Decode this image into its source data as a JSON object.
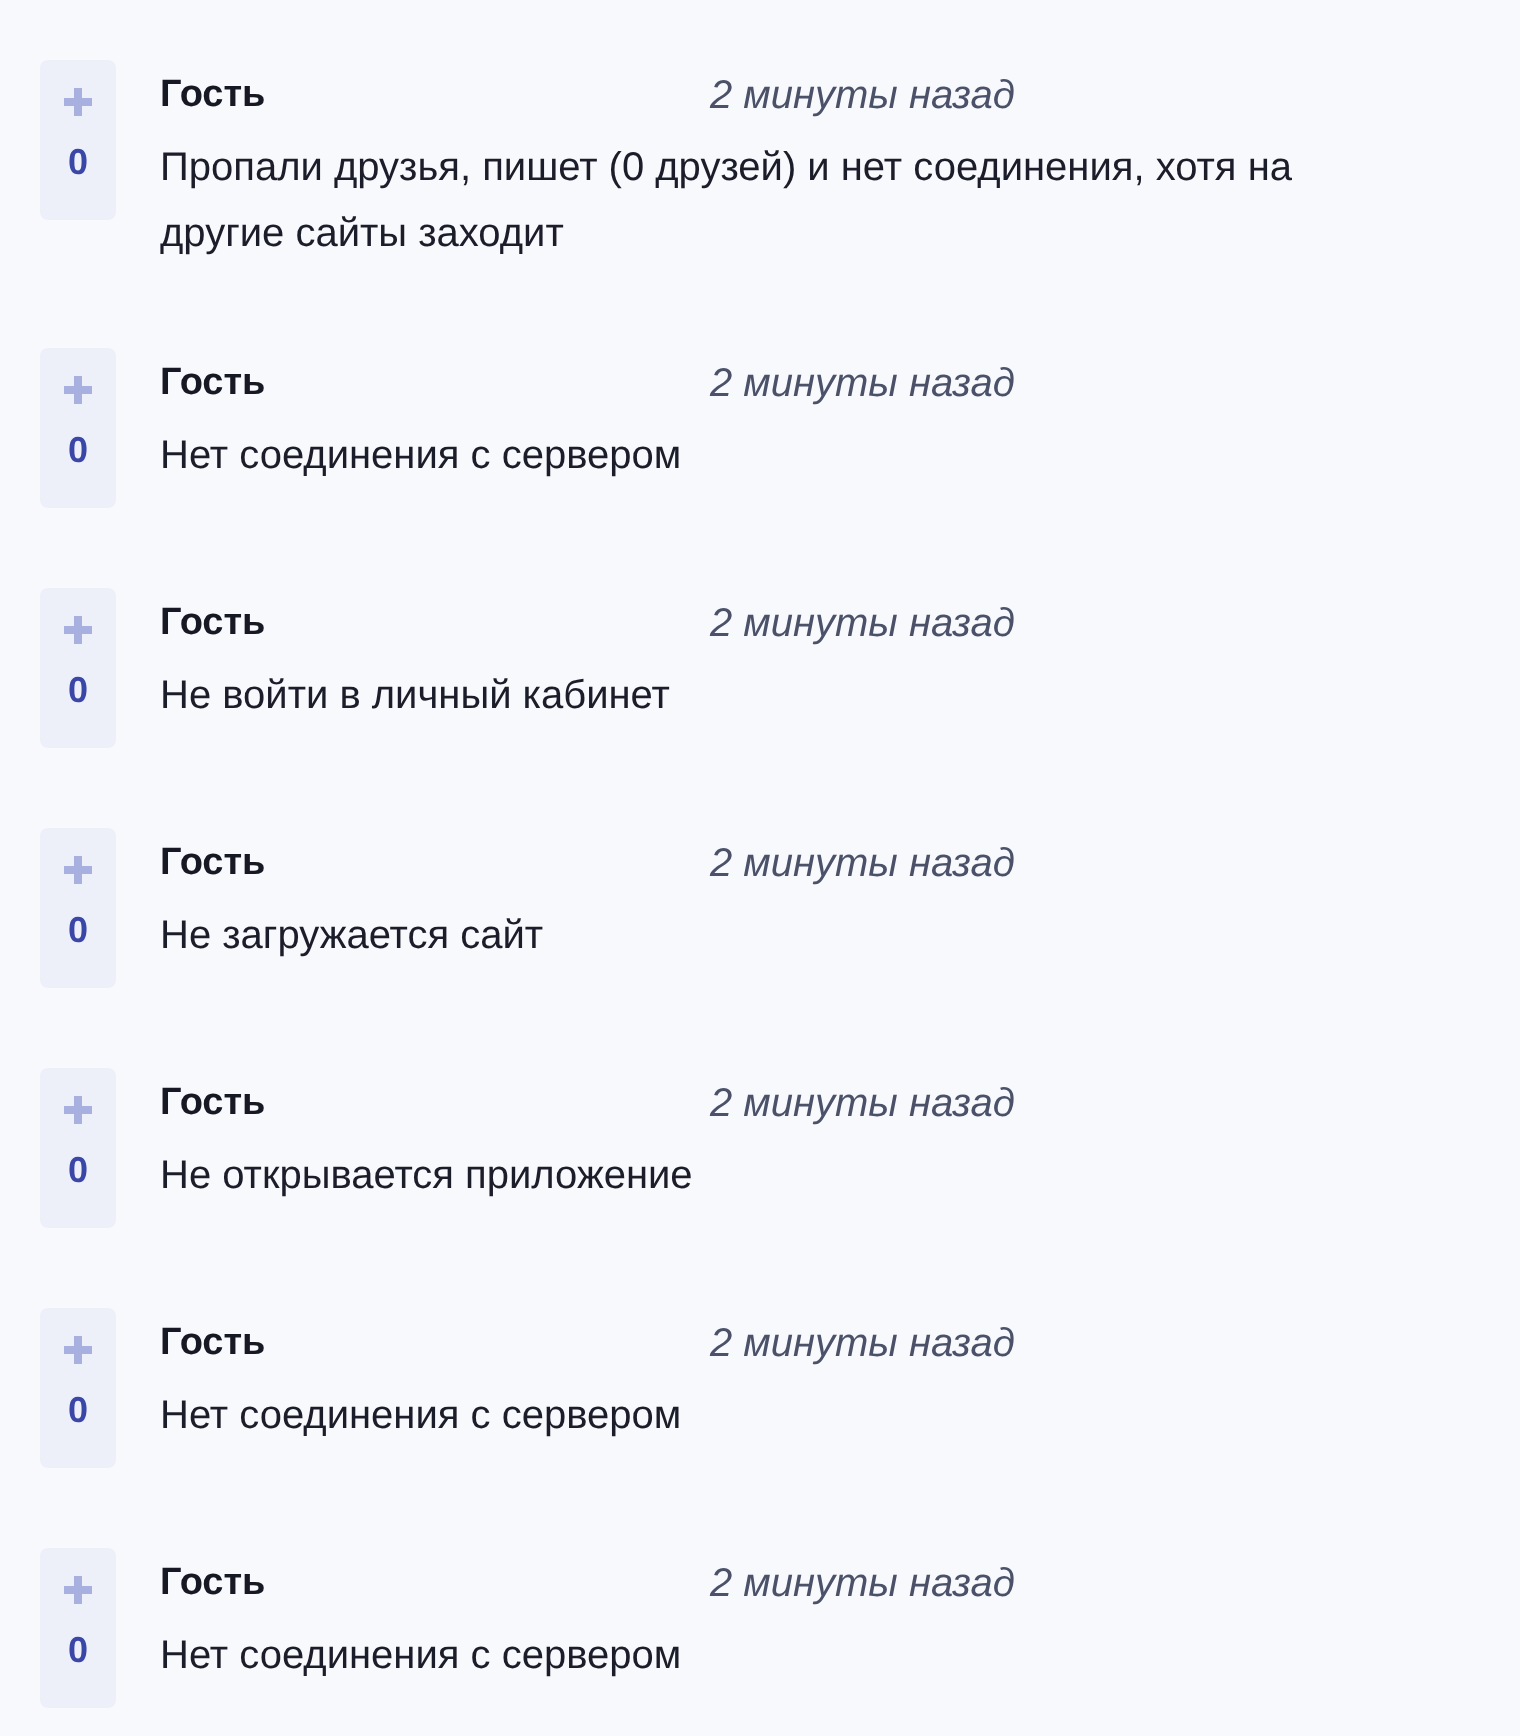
{
  "comments": [
    {
      "author": "Гость",
      "time": "2 минуты назад",
      "text": "Пропали друзья, пишет (0 друзей) и нет соединения, хотя на другие сайты заходит",
      "votes": "0"
    },
    {
      "author": "Гость",
      "time": "2 минуты назад",
      "text": "Нет соединения с сервером",
      "votes": "0"
    },
    {
      "author": "Гость",
      "time": "2 минуты назад",
      "text": "Не войти в личный кабинет",
      "votes": "0"
    },
    {
      "author": "Гость",
      "time": "2 минуты назад",
      "text": "Не загружается сайт",
      "votes": "0"
    },
    {
      "author": "Гость",
      "time": "2 минуты назад",
      "text": "Не открывается приложение",
      "votes": "0"
    },
    {
      "author": "Гость",
      "time": "2 минуты назад",
      "text": "Нет соединения с сервером",
      "votes": "0"
    },
    {
      "author": "Гость",
      "time": "2 минуты назад",
      "text": "Нет соединения с сервером",
      "votes": "0"
    }
  ]
}
